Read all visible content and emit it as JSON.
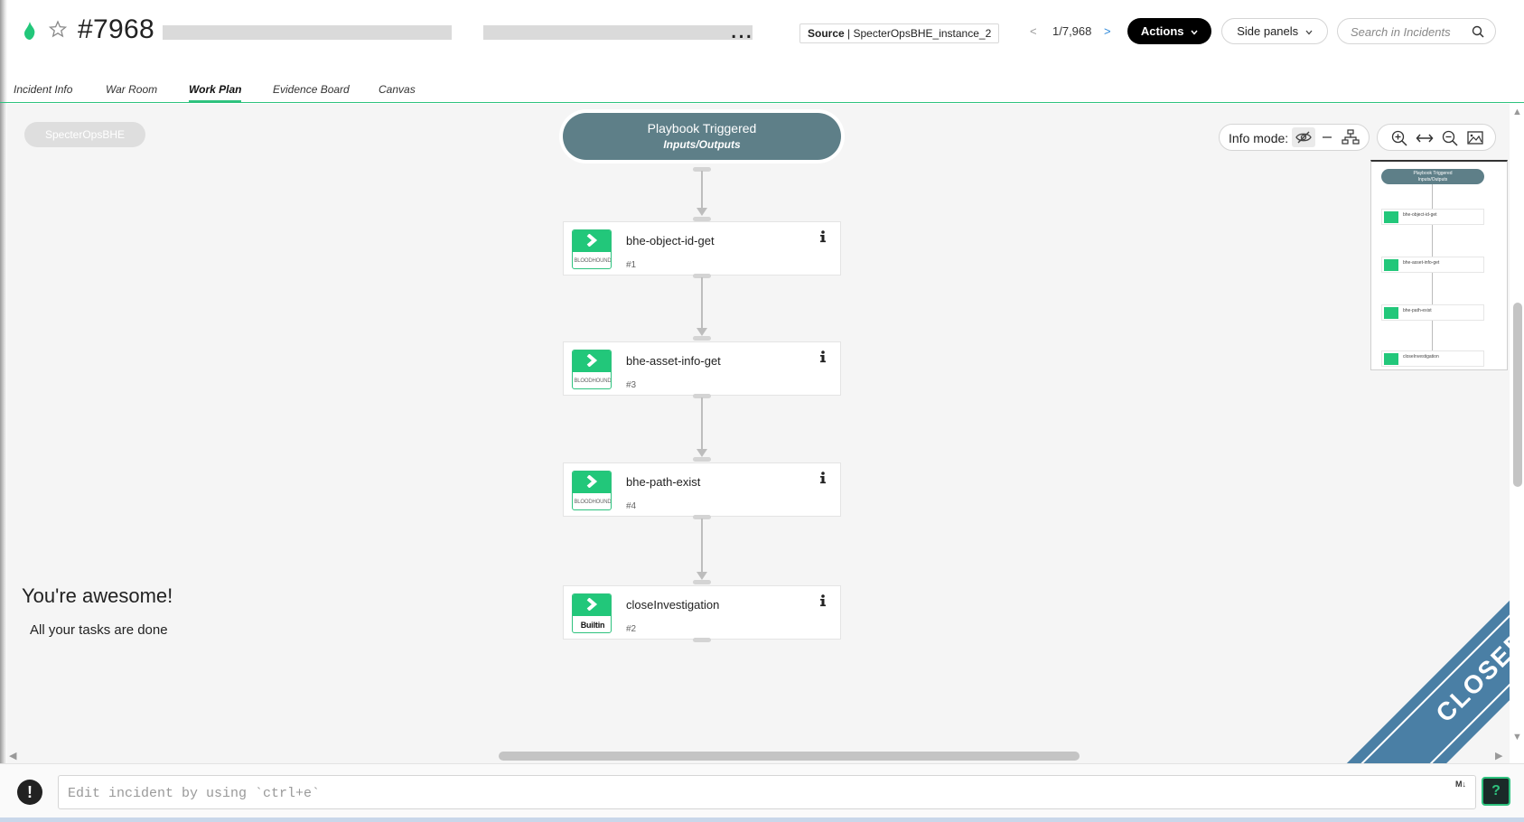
{
  "header": {
    "incident_title": "#7968",
    "title_tail": "...",
    "source_label": "Source",
    "source_value": "SpecterOpsBHE_instance_2",
    "nav_prev": "<",
    "nav_count": "1/7,968",
    "nav_next": ">",
    "actions_label": "Actions",
    "side_panels_label": "Side panels",
    "search_placeholder": "Search in Incidents"
  },
  "tabs": [
    {
      "label": "Incident Info"
    },
    {
      "label": "War Room"
    },
    {
      "label": "Work Plan",
      "active": true
    },
    {
      "label": "Evidence Board"
    },
    {
      "label": "Canvas"
    }
  ],
  "canvas": {
    "brand_chip": "SpecterOpsBHE",
    "trigger_title": "Playbook Triggered",
    "trigger_subtitle": "Inputs/Outputs",
    "tasks": [
      {
        "name": "bhe-object-id-get",
        "number": "#1",
        "icon_caption": "BLOODHOUND"
      },
      {
        "name": "bhe-asset-info-get",
        "number": "#3",
        "icon_caption": "BLOODHOUND"
      },
      {
        "name": "bhe-path-exist",
        "number": "#4",
        "icon_caption": "BLOODHOUND"
      },
      {
        "name": "closeInvestigation",
        "number": "#2",
        "icon_caption": "Builtin"
      }
    ],
    "info_mode_label": "Info mode:",
    "minimap": {
      "trigger_title": "Playbook Triggered",
      "trigger_subtitle": "Inputs/Outputs",
      "tasks": [
        "bhe-object-id-get",
        "bhe-asset-info-get",
        "bhe-path-exist",
        "closeInvestigation"
      ]
    },
    "done_title": "You're awesome!",
    "done_message": "All your tasks are done",
    "status_ribbon": "CLOSED"
  },
  "bottom": {
    "command_placeholder": "Edit incident by using `ctrl+e`",
    "markdown_badge": "M↓",
    "help_label": "?"
  },
  "colors": {
    "accent_green": "#2ec27e",
    "trigger_slate": "#5e7f88",
    "ribbon_blue": "#4a7fa5"
  }
}
